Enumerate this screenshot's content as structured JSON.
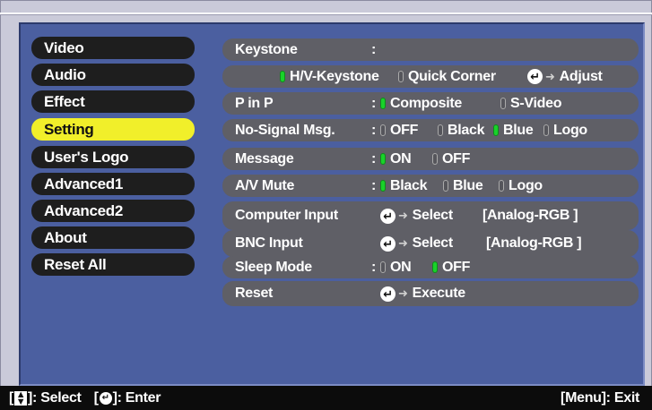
{
  "menu": [
    {
      "label": "Video",
      "active": false
    },
    {
      "label": "Audio",
      "active": false
    },
    {
      "label": "Effect",
      "active": false
    },
    {
      "label": "Setting",
      "active": true
    },
    {
      "label": "User's Logo",
      "active": false
    },
    {
      "label": "Advanced1",
      "active": false
    },
    {
      "label": "Advanced2",
      "active": false
    },
    {
      "label": "About",
      "active": false
    },
    {
      "label": "Reset All",
      "active": false
    }
  ],
  "settings": {
    "keystone": {
      "label": "Keystone",
      "colon": ":"
    },
    "keystone_mode": {
      "hv": "H/V-Keystone",
      "quick": "Quick Corner",
      "adjust": "Adjust",
      "selected": "H/V-Keystone"
    },
    "pinp": {
      "label": "P in P",
      "colon": ":",
      "opt1": "Composite",
      "opt2": "S-Video",
      "selected": "Composite"
    },
    "nosignal": {
      "label": "No-Signal Msg.",
      "colon": ":",
      "opt1": "OFF",
      "opt2": "Black",
      "opt3": "Blue",
      "opt4": "Logo",
      "selected": "Blue"
    },
    "message": {
      "label": "Message",
      "colon": ":",
      "opt1": "ON",
      "opt2": "OFF",
      "selected": "ON"
    },
    "avmute": {
      "label": "A/V Mute",
      "colon": ":",
      "opt1": "Black",
      "opt2": "Blue",
      "opt3": "Logo",
      "selected": "Black"
    },
    "computer_input": {
      "label": "Computer Input",
      "action": "Select",
      "value": "[Analog-RGB  ]"
    },
    "bnc_input": {
      "label": "BNC Input",
      "action": "Select",
      "value": "[Analog-RGB  ]"
    },
    "sleep": {
      "label": "Sleep Mode",
      "colon": ":",
      "opt1": "ON",
      "opt2": "OFF",
      "selected": "OFF"
    },
    "reset": {
      "label": "Reset",
      "action": "Execute"
    }
  },
  "footer": {
    "select_hint": "]: Select",
    "enter_hint": "]: Enter",
    "exit_hint": "[Menu]: Exit"
  },
  "colors": {
    "active_menu": "#f1ef2a",
    "radio_on": "#19d22a",
    "panel": "#4b5fa0"
  }
}
